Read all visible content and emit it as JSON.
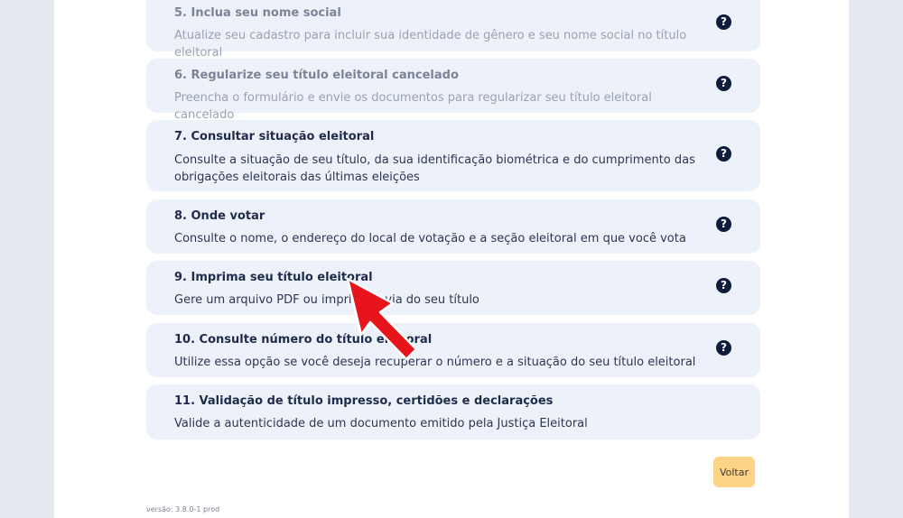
{
  "items": [
    {
      "title": "5. Inclua seu nome social",
      "desc": "Atualize seu cadastro para incluir sua identidade de gênero e seu nome social no título eleitoral",
      "muted": true,
      "help": true
    },
    {
      "title": "6. Regularize seu título eleitoral cancelado",
      "desc": "Preencha o formulário e envie os documentos para regularizar seu título eleitoral cancelado",
      "muted": true,
      "help": true
    },
    {
      "title": "7. Consultar situação eleitoral",
      "desc": "Consulte a situação de seu título, da sua identificação biométrica e do cumprimento das obrigações eleitorais das últimas eleições",
      "muted": false,
      "help": true
    },
    {
      "title": "8. Onde votar",
      "desc": "Consulte o nome, o endereço do local de votação e a seção eleitoral em que você vota",
      "muted": false,
      "help": true
    },
    {
      "title": "9. Imprima seu título eleitoral",
      "desc": "Gere um arquivo PDF ou imprima a via do seu título",
      "muted": false,
      "help": true
    },
    {
      "title": "10. Consulte número do título eleitoral",
      "desc": "Utilize essa opção se você deseja recuperar o número e a situação do seu título eleitoral",
      "muted": false,
      "help": true
    },
    {
      "title": "11. Validação de título impresso, certidões e declarações",
      "desc": "Valide a autenticidade de um documento emitido pela Justiça Eleitoral",
      "muted": false,
      "help": false
    }
  ],
  "help_glyph": "?",
  "back_label": "Voltar",
  "version_text": "versão: 3.8.0-1 prod",
  "colors": {
    "card_bg": "#edf1fa",
    "back_button": "#fdd486",
    "arrow": "#e8141b"
  }
}
